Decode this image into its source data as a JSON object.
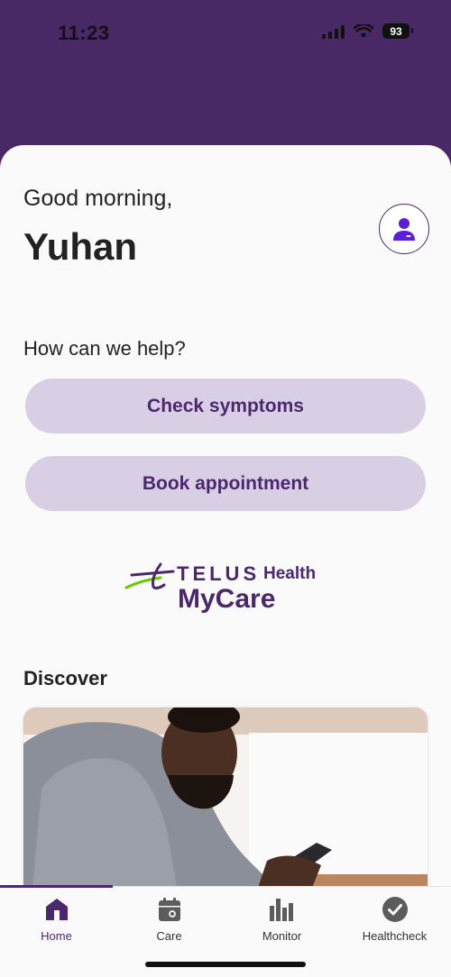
{
  "status_bar": {
    "time": "11:23",
    "battery": "93"
  },
  "greeting": {
    "salutation": "Good morning,",
    "name": "Yuhan"
  },
  "help": {
    "heading": "How can we help?",
    "check_symptoms_label": "Check symptoms",
    "book_appointment_label": "Book appointment"
  },
  "logo": {
    "brand": "TELUS",
    "brand_suffix": "Health",
    "product": "MyCare"
  },
  "discover": {
    "heading": "Discover"
  },
  "tabbar": {
    "tabs": [
      {
        "label": "Home",
        "icon": "home-icon",
        "active": true
      },
      {
        "label": "Care",
        "icon": "calendar-icon",
        "active": false
      },
      {
        "label": "Monitor",
        "icon": "bar-chart-icon",
        "active": false
      },
      {
        "label": "Healthcheck",
        "icon": "check-circle-icon",
        "active": false
      }
    ]
  },
  "colors": {
    "brand_purple": "#4b286d",
    "header_purple": "#482865",
    "pill_background": "#d8cfe5",
    "logo_green": "#66cc00",
    "background": "#fafafa"
  }
}
